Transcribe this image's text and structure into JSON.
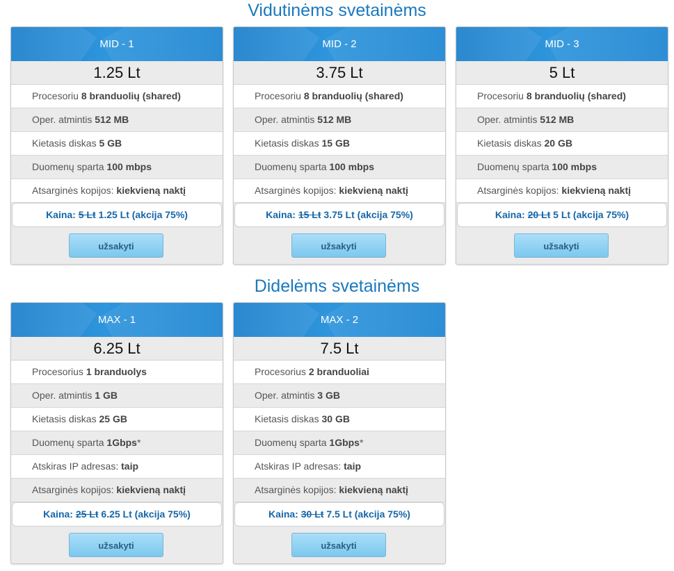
{
  "sections": [
    {
      "title": "Vidutinėms svetainėms",
      "plans": [
        {
          "name": "MID - 1",
          "price": "1.25 Lt",
          "features": [
            {
              "label": "Procesoriu",
              "value": "8 branduolių (shared)"
            },
            {
              "label": "Oper. atmintis",
              "value": "512 MB"
            },
            {
              "label": "Kietasis diskas",
              "value": "5 GB"
            },
            {
              "label": "Duomenų sparta",
              "value": "100 mbps"
            },
            {
              "label": "Atsarginės kopijos:",
              "value": "kiekvieną naktį"
            }
          ],
          "kaina_label": "Kaina:",
          "old_price": "5 Lt",
          "new_price": "1.25 Lt (akcija 75%)",
          "button": "užsakyti"
        },
        {
          "name": "MID - 2",
          "price": "3.75 Lt",
          "features": [
            {
              "label": "Procesoriu",
              "value": "8 branduolių (shared)"
            },
            {
              "label": "Oper. atmintis",
              "value": "512 MB"
            },
            {
              "label": "Kietasis diskas",
              "value": "15 GB"
            },
            {
              "label": "Duomenų sparta",
              "value": "100 mbps"
            },
            {
              "label": "Atsarginės kopijos:",
              "value": "kiekvieną naktį"
            }
          ],
          "kaina_label": "Kaina:",
          "old_price": "15 Lt",
          "new_price": "3.75 Lt (akcija 75%)",
          "button": "užsakyti"
        },
        {
          "name": "MID - 3",
          "price": "5 Lt",
          "features": [
            {
              "label": "Procesoriu",
              "value": "8 branduolių (shared)"
            },
            {
              "label": "Oper. atmintis",
              "value": "512 MB"
            },
            {
              "label": "Kietasis diskas",
              "value": "20 GB"
            },
            {
              "label": "Duomenų sparta",
              "value": "100 mbps"
            },
            {
              "label": "Atsarginės kopijos:",
              "value": "kiekvieną naktį"
            }
          ],
          "kaina_label": "Kaina:",
          "old_price": "20 Lt",
          "new_price": "5 Lt (akcija 75%)",
          "button": "užsakyti"
        }
      ]
    },
    {
      "title": "Didelėms svetainėms",
      "plans": [
        {
          "name": "MAX - 1",
          "price": "6.25 Lt",
          "features": [
            {
              "label": "Procesorius",
              "value": "1 branduolys"
            },
            {
              "label": "Oper. atmintis",
              "value": "1 GB"
            },
            {
              "label": "Kietasis diskas",
              "value": "25 GB"
            },
            {
              "label": "Duomenų sparta",
              "value": "1Gbps",
              "suffix": "*"
            },
            {
              "label": "Atskiras IP adresas:",
              "value": "taip"
            },
            {
              "label": "Atsarginės kopijos:",
              "value": "kiekvieną naktį"
            }
          ],
          "kaina_label": "Kaina:",
          "old_price": "25 Lt",
          "new_price": "6.25 Lt (akcija 75%)",
          "button": "užsakyti"
        },
        {
          "name": "MAX - 2",
          "price": "7.5 Lt",
          "features": [
            {
              "label": "Procesorius",
              "value": "2 branduoliai"
            },
            {
              "label": "Oper. atmintis",
              "value": "3 GB"
            },
            {
              "label": "Kietasis diskas",
              "value": "30 GB"
            },
            {
              "label": "Duomenų sparta",
              "value": "1Gbps",
              "suffix": "*"
            },
            {
              "label": "Atskiras IP adresas:",
              "value": "taip"
            },
            {
              "label": "Atsarginės kopijos:",
              "value": "kiekvieną naktį"
            }
          ],
          "kaina_label": "Kaina:",
          "old_price": "30 Lt",
          "new_price": "7.5 Lt (akcija 75%)",
          "button": "užsakyti"
        }
      ]
    }
  ]
}
